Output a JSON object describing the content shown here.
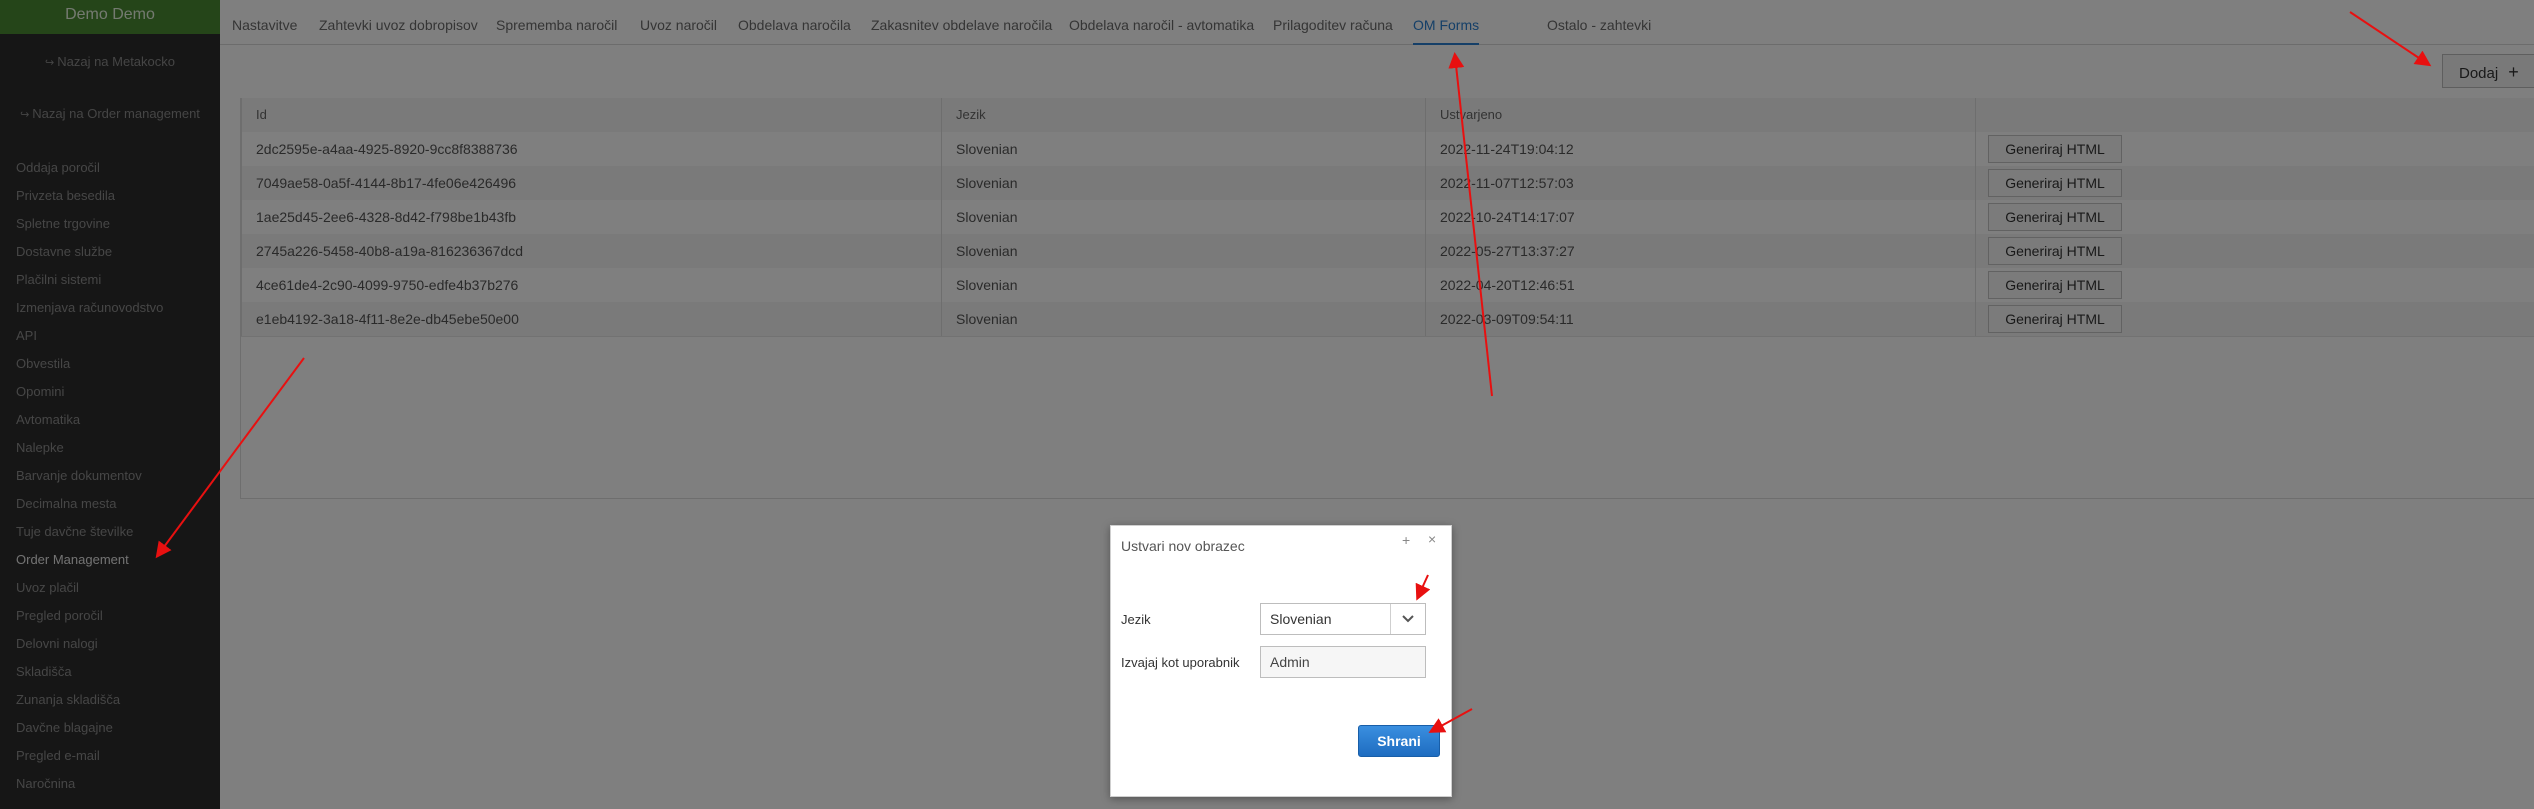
{
  "sidebar": {
    "brand": "Demo Demo",
    "back_metakocka": "Nazaj na Metakocko",
    "back_order_management": "Nazaj na Order management",
    "items": [
      "Oddaja poročil",
      "Privzeta besedila",
      "Spletne trgovine",
      "Dostavne službe",
      "Plačilni sistemi",
      "Izmenjava računovodstvo",
      "API",
      "Obvestila",
      "Opomini",
      "Avtomatika",
      "Nalepke",
      "Barvanje dokumentov",
      "Decimalna mesta",
      "Tuje davčne številke",
      "Order Management",
      "Uvoz plačil",
      "Pregled poročil",
      "Delovni nalogi",
      "Skladišča",
      "Zunanja skladišča",
      "Davčne blagajne",
      "Pregled e-mail",
      "Naročnina"
    ],
    "active_item": "Order Management"
  },
  "tabs": [
    "Nastavitve",
    "Zahtevki uvoz dobropisov",
    "Sprememba naročil",
    "Uvoz naročil",
    "Obdelava naročila",
    "Zakasnitev obdelave naročila",
    "Obdelava naročil - avtomatika",
    "Prilagoditev računa",
    "OM Forms",
    "Ostalo - zahtevki"
  ],
  "active_tab": "OM Forms",
  "toolbar": {
    "add_label": "Dodaj",
    "add_icon": "plus"
  },
  "grid": {
    "columns": [
      "Id",
      "Jezik",
      "Ustvarjeno",
      ""
    ],
    "button_label": "Generiraj HTML",
    "rows": [
      {
        "id": "2dc2595e-a4aa-4925-8920-9cc8f8388736",
        "jezik": "Slovenian",
        "ustvarjeno": "2022-11-24T19:04:12"
      },
      {
        "id": "7049ae58-0a5f-4144-8b17-4fe06e426496",
        "jezik": "Slovenian",
        "ustvarjeno": "2022-11-07T12:57:03"
      },
      {
        "id": "1ae25d45-2ee6-4328-8d42-f798be1b43fb",
        "jezik": "Slovenian",
        "ustvarjeno": "2022-10-24T14:17:07"
      },
      {
        "id": "2745a226-5458-40b8-a19a-816236367dcd",
        "jezik": "Slovenian",
        "ustvarjeno": "2022-05-27T13:37:27"
      },
      {
        "id": "4ce61de4-2c90-4099-9750-edfe4b37b276",
        "jezik": "Slovenian",
        "ustvarjeno": "2022-04-20T12:46:51"
      },
      {
        "id": "e1eb4192-3a18-4f11-8e2e-db45ebe50e00",
        "jezik": "Slovenian",
        "ustvarjeno": "2022-03-09T09:54:11"
      }
    ]
  },
  "dialog": {
    "title": "Ustvari nov obrazec",
    "maximize_glyph": "+",
    "close_glyph": "×",
    "language_label": "Jezik",
    "language_value": "Slovenian",
    "user_label": "Izvajaj kot uporabnik",
    "user_value": "Admin",
    "save_label": "Shrani"
  },
  "colors": {
    "brand_green": "#4a8a33",
    "sidebar_bg": "#2d2d2d",
    "accent_blue": "#2a7fd0",
    "save_blue": "#1e6cc0",
    "annotation_red": "#e81010"
  }
}
